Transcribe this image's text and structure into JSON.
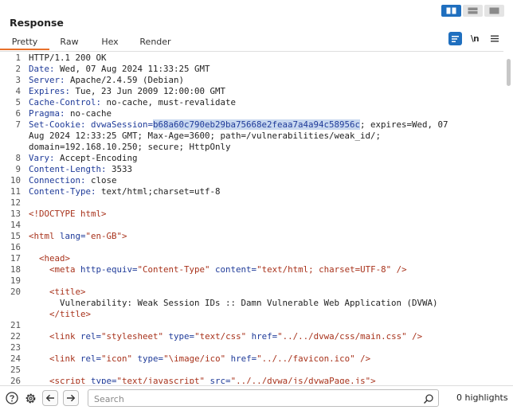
{
  "panel": {
    "title": "Response"
  },
  "tabs": [
    {
      "label": "Pretty",
      "active": true
    },
    {
      "label": "Raw",
      "active": false
    },
    {
      "label": "Hex",
      "active": false
    },
    {
      "label": "Render",
      "active": false
    }
  ],
  "tools": {
    "newline_label": "\\n"
  },
  "lines": [
    {
      "n": "1",
      "s": [
        {
          "t": "HTTP/1.1 200 OK",
          "c": ""
        }
      ]
    },
    {
      "n": "2",
      "s": [
        {
          "t": "Date: ",
          "c": "hn"
        },
        {
          "t": "Wed, 07 Aug 2024 11:33:25 GMT",
          "c": ""
        }
      ]
    },
    {
      "n": "3",
      "s": [
        {
          "t": "Server: ",
          "c": "hn"
        },
        {
          "t": "Apache/2.4.59 (Debian)",
          "c": ""
        }
      ]
    },
    {
      "n": "4",
      "s": [
        {
          "t": "Expires: ",
          "c": "hn"
        },
        {
          "t": "Tue, 23 Jun 2009 12:00:00 GMT",
          "c": ""
        }
      ]
    },
    {
      "n": "5",
      "s": [
        {
          "t": "Cache-Control: ",
          "c": "hn"
        },
        {
          "t": "no-cache, must-revalidate",
          "c": ""
        }
      ]
    },
    {
      "n": "6",
      "s": [
        {
          "t": "Pragma: ",
          "c": "hn"
        },
        {
          "t": "no-cache",
          "c": ""
        }
      ]
    },
    {
      "n": "7",
      "s": [
        {
          "t": "Set-Cookie: ",
          "c": "hn"
        },
        {
          "t": "dvwaSession=",
          "c": "hn"
        },
        {
          "t": "b68a60c790eb29ba75668e2feaa7a4a94c58956c",
          "c": "sel"
        },
        {
          "t": "; expires=Wed, 07",
          "c": ""
        }
      ]
    },
    {
      "n": "",
      "s": [
        {
          "t": "Aug 2024 12:33:25 GMT; Max-Age=3600; path=/vulnerabilities/weak_id/;",
          "c": ""
        }
      ]
    },
    {
      "n": "",
      "s": [
        {
          "t": "domain=192.168.10.250; secure; HttpOnly",
          "c": ""
        }
      ]
    },
    {
      "n": "8",
      "s": [
        {
          "t": "Vary: ",
          "c": "hn"
        },
        {
          "t": "Accept-Encoding",
          "c": ""
        }
      ]
    },
    {
      "n": "9",
      "s": [
        {
          "t": "Content-Length: ",
          "c": "hn"
        },
        {
          "t": "3533",
          "c": ""
        }
      ]
    },
    {
      "n": "10",
      "s": [
        {
          "t": "Connection: ",
          "c": "hn"
        },
        {
          "t": "close",
          "c": ""
        }
      ]
    },
    {
      "n": "11",
      "s": [
        {
          "t": "Content-Type: ",
          "c": "hn"
        },
        {
          "t": "text/html;charset=utf-8",
          "c": ""
        }
      ]
    },
    {
      "n": "12",
      "s": []
    },
    {
      "n": "13",
      "s": [
        {
          "t": "<!DOCTYPE html>",
          "c": "tag"
        }
      ]
    },
    {
      "n": "14",
      "s": []
    },
    {
      "n": "15",
      "s": [
        {
          "t": "<html ",
          "c": "tag"
        },
        {
          "t": "lang=",
          "c": "attr"
        },
        {
          "t": "\"en-GB\"",
          "c": "val"
        },
        {
          "t": ">",
          "c": "tag"
        }
      ]
    },
    {
      "n": "16",
      "s": []
    },
    {
      "n": "17",
      "s": [
        {
          "t": "  <head>",
          "c": "tag"
        }
      ]
    },
    {
      "n": "18",
      "s": [
        {
          "t": "    <meta ",
          "c": "tag"
        },
        {
          "t": "http-equiv=",
          "c": "attr"
        },
        {
          "t": "\"Content-Type\" ",
          "c": "val"
        },
        {
          "t": "content=",
          "c": "attr"
        },
        {
          "t": "\"text/html; charset=UTF-8\" ",
          "c": "val"
        },
        {
          "t": "/>",
          "c": "tag"
        }
      ]
    },
    {
      "n": "19",
      "s": []
    },
    {
      "n": "20",
      "s": [
        {
          "t": "    <title>",
          "c": "tag"
        }
      ]
    },
    {
      "n": "",
      "s": [
        {
          "t": "      Vulnerability: Weak Session IDs :: Damn Vulnerable Web Application (DVWA)",
          "c": ""
        }
      ]
    },
    {
      "n": "",
      "s": [
        {
          "t": "    </title>",
          "c": "tag"
        }
      ]
    },
    {
      "n": "21",
      "s": []
    },
    {
      "n": "22",
      "s": [
        {
          "t": "    <link ",
          "c": "tag"
        },
        {
          "t": "rel=",
          "c": "attr"
        },
        {
          "t": "\"stylesheet\" ",
          "c": "val"
        },
        {
          "t": "type=",
          "c": "attr"
        },
        {
          "t": "\"text/css\" ",
          "c": "val"
        },
        {
          "t": "href=",
          "c": "attr"
        },
        {
          "t": "\"../../dvwa/css/main.css\" ",
          "c": "val"
        },
        {
          "t": "/>",
          "c": "tag"
        }
      ]
    },
    {
      "n": "23",
      "s": []
    },
    {
      "n": "24",
      "s": [
        {
          "t": "    <link ",
          "c": "tag"
        },
        {
          "t": "rel=",
          "c": "attr"
        },
        {
          "t": "\"icon\" ",
          "c": "val"
        },
        {
          "t": "type=",
          "c": "attr"
        },
        {
          "t": "\"\\image/ico\" ",
          "c": "val"
        },
        {
          "t": "href=",
          "c": "attr"
        },
        {
          "t": "\"../../favicon.ico\" ",
          "c": "val"
        },
        {
          "t": "/>",
          "c": "tag"
        }
      ]
    },
    {
      "n": "25",
      "s": []
    },
    {
      "n": "26",
      "s": [
        {
          "t": "    <script ",
          "c": "tag"
        },
        {
          "t": "type=",
          "c": "attr"
        },
        {
          "t": "\"text/javascript\" ",
          "c": "val"
        },
        {
          "t": "src=",
          "c": "attr"
        },
        {
          "t": "\"../../dvwa/js/dvwaPage.js\"",
          "c": "val"
        },
        {
          "t": ">",
          "c": "tag"
        }
      ]
    }
  ],
  "search": {
    "placeholder": "Search",
    "value": ""
  },
  "highlights": {
    "label": "0 highlights"
  },
  "colors": {
    "accent_blue": "#1f6fbf",
    "tab_underline": "#e8702a",
    "header_name": "#1f3b99",
    "tag_red": "#a8321b"
  }
}
